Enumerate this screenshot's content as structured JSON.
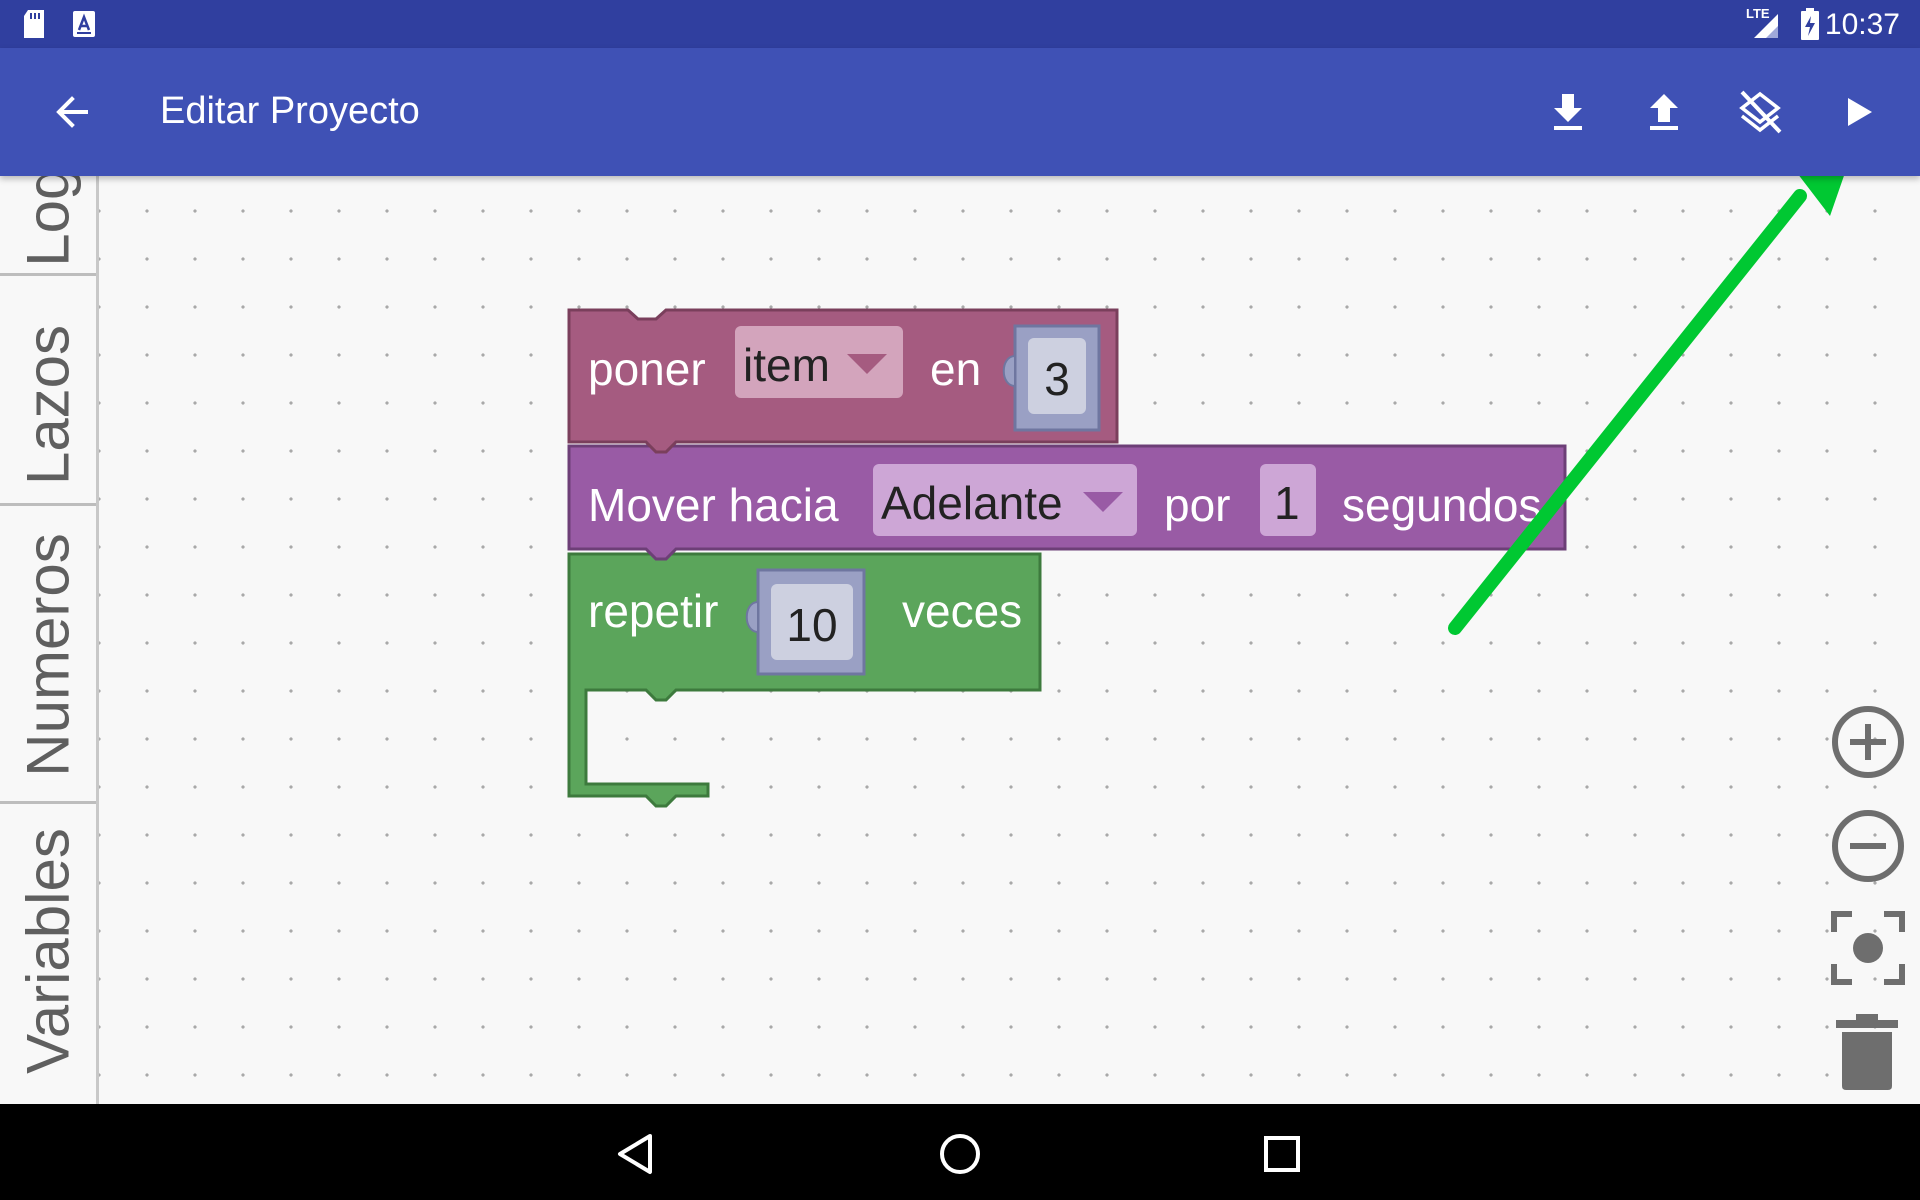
{
  "status_bar": {
    "time": "10:37",
    "network": "LTE",
    "icons": [
      "sd-card-icon",
      "font-app-icon",
      "lte-signal-icon",
      "battery-charging-icon"
    ]
  },
  "app_bar": {
    "title": "Editar Proyecto",
    "actions": [
      "back-arrow-icon",
      "download-icon",
      "upload-icon",
      "clear-layers-icon",
      "play-icon"
    ]
  },
  "toolbox": {
    "categories": [
      "Logi",
      "Lazos",
      "Numeros",
      "Variables"
    ]
  },
  "blocks": {
    "set_block": {
      "label_start": "poner",
      "variable": "item",
      "label_mid": "en",
      "value": "3"
    },
    "move_block": {
      "label_start": "Mover hacia",
      "direction": "Adelante",
      "label_mid": "por",
      "value": "1",
      "label_end": "segundos"
    },
    "repeat_block": {
      "label_start": "repetir",
      "value": "10",
      "label_end": "veces"
    }
  },
  "workspace_controls": [
    "zoom-in-icon",
    "zoom-out-icon",
    "recenter-icon",
    "trash-icon"
  ],
  "navigation_bar": [
    "nav-back-icon",
    "nav-home-icon",
    "nav-recents-icon"
  ],
  "colors": {
    "status_bar": "#303f9f",
    "app_bar": "#3f51b5",
    "set_block": "#a55b80",
    "move_block": "#995ba5",
    "repeat_block": "#5ba55b",
    "annotation_arrow": "#00c832"
  }
}
